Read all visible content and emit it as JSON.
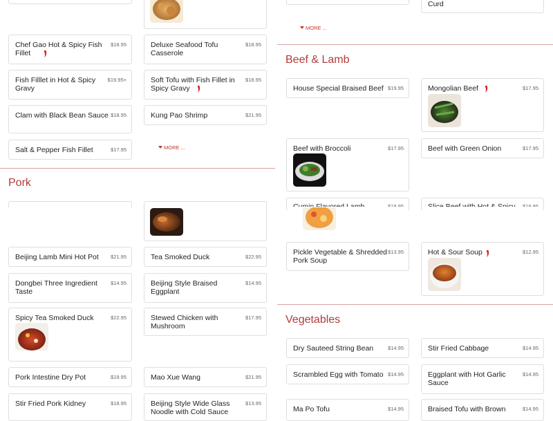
{
  "sections": {
    "beef_lamb": "Beef & Lamb",
    "pork": "Pork",
    "vegetables": "Vegetables"
  },
  "more_label": "MORE ...",
  "left": {
    "top_items": [
      {
        "name": "",
        "price": ""
      },
      {
        "name": "",
        "price": ""
      },
      {
        "name": "Chef Gao Hot & Spicy Fish Fillet",
        "price": "$18.95"
      },
      {
        "name": "Deluxe Seafood Tofu Casserole",
        "price": "$18.95"
      },
      {
        "name": "Fish Filllet in Hot & Spicy Gravy",
        "price": "$19.95+"
      },
      {
        "name": "Soft Tofu with Fish Fillet in Spicy Gravy",
        "price": "$18.95"
      },
      {
        "name": "Clam with Black Bean Sauce",
        "price": "$18.95"
      },
      {
        "name": "Kung Pao Shrimp",
        "price": "$21.95"
      },
      {
        "name": "Salt & Pepper Fish Fillet",
        "price": "$17.95"
      }
    ],
    "pork_items": [
      {
        "name": "",
        "price": ""
      },
      {
        "name": "",
        "price": ""
      },
      {
        "name": "Beijing Lamb Mini Hot Pot",
        "price": "$21.95"
      },
      {
        "name": "Tea Smoked Duck",
        "price": "$22.95"
      },
      {
        "name": "Dongbei Three Ingredient Taste",
        "price": "$14.95"
      },
      {
        "name": "Beijing Style Braised Eggplant",
        "price": "$14.95"
      },
      {
        "name": "Spicy Tea Smoked Duck",
        "price": "$22.95"
      },
      {
        "name": "Stewed Chicken with Mushroom",
        "price": "$17.95"
      },
      {
        "name": "Pork Intestine Dry Pot",
        "price": "$19.95"
      },
      {
        "name": "Mao Xue Wang",
        "price": "$21.95"
      },
      {
        "name": "Stir Fried Pork Kidney",
        "price": "$18.95"
      },
      {
        "name": "Beijing Style Wide Glass Noodle with Cold Sauce",
        "price": "$13.95"
      }
    ]
  },
  "right": {
    "top_items": [
      {
        "name": "",
        "price": ""
      },
      {
        "name": "Curd",
        "price": ""
      }
    ],
    "beef_items": [
      {
        "name": "House Special Braised Beef",
        "price": "$19.95"
      },
      {
        "name": "Mongolian Beef",
        "price": "$17.95"
      },
      {
        "name": "Beef with Broccoli",
        "price": "$17.95"
      },
      {
        "name": "Beef with Green Onion",
        "price": "$17.95"
      },
      {
        "name": "Cumin Flavored Lamb",
        "price": "$19.95"
      },
      {
        "name": "Slice Beef with Hot & Spicy",
        "price": "$19.95"
      },
      {
        "name": "Pickle Vegetable & Shredded Pork Soup",
        "price": "$13.95"
      },
      {
        "name": "Hot & Sour Soup",
        "price": "$12.95"
      }
    ],
    "veg_items": [
      {
        "name": "Dry Sauteed String Bean",
        "price": "$14.95"
      },
      {
        "name": "Stir Fried Cabbage",
        "price": "$14.95"
      },
      {
        "name": "Scrambled Egg with Tomato",
        "price": "$14.95"
      },
      {
        "name": "Eggplant with Hot Garlic Sauce",
        "price": "$14.95"
      },
      {
        "name": "Ma Po Tofu",
        "price": "$14.95"
      },
      {
        "name": "Braised Tofu with Brown",
        "price": "$14.95"
      }
    ]
  },
  "colors": {
    "accent": "#b03a3a",
    "pepper": "#d62828"
  }
}
